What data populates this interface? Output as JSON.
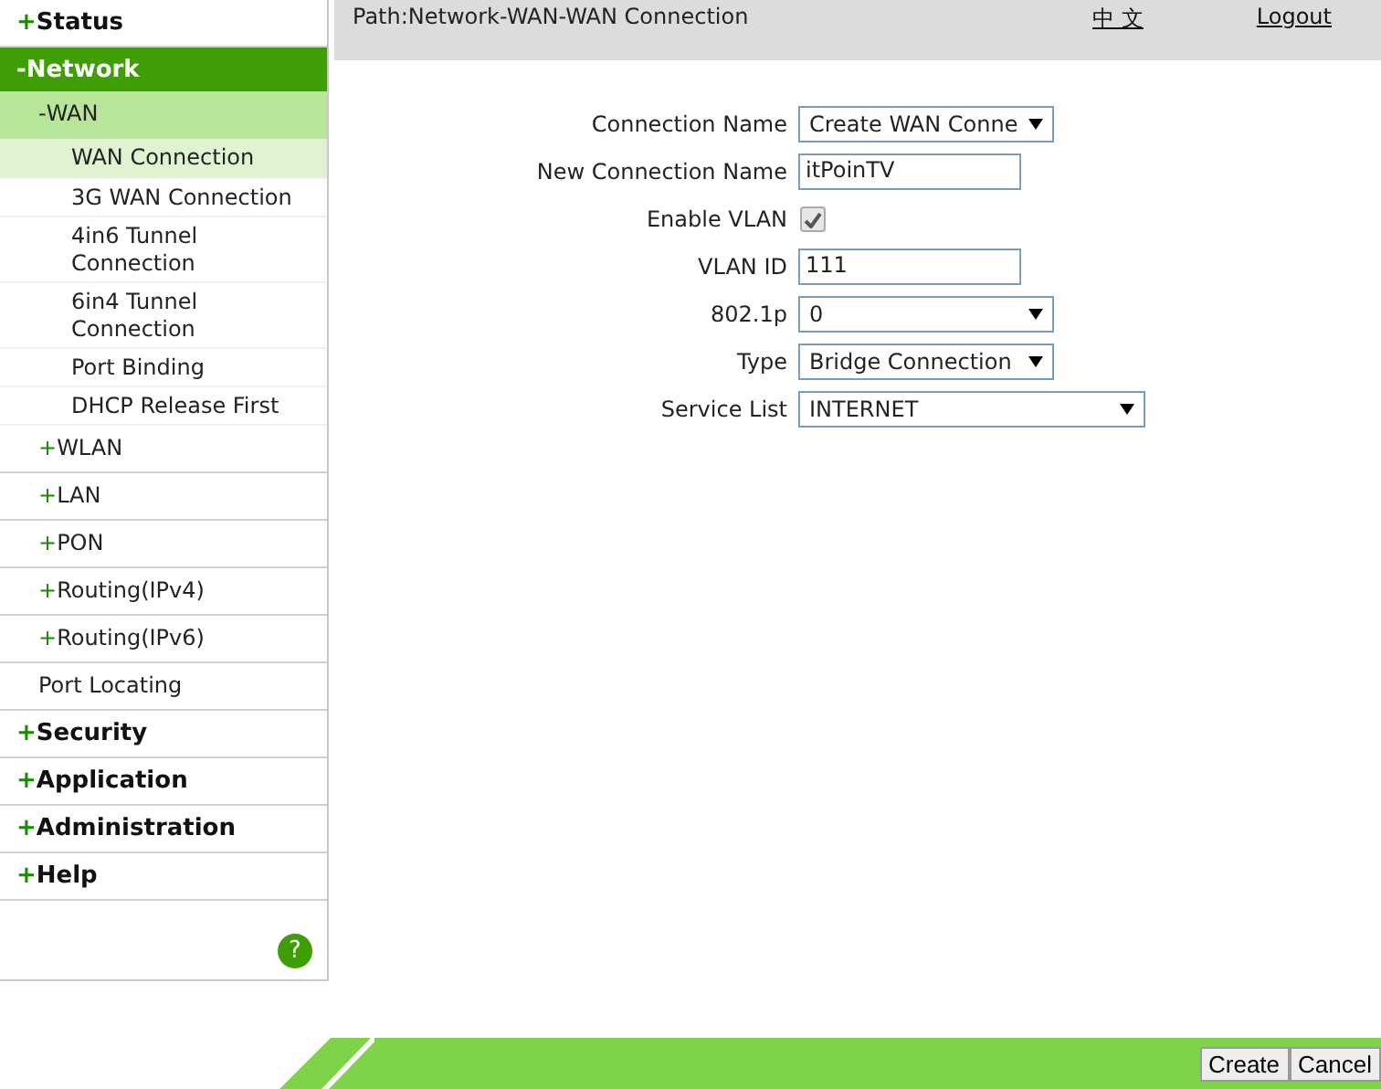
{
  "sidebar": {
    "items": [
      {
        "marker": "+",
        "label": "Status",
        "selected": false
      },
      {
        "marker": "-",
        "label": "Network",
        "selected": true,
        "children": [
          {
            "marker": "-",
            "label": "WAN",
            "selected": true,
            "children": [
              {
                "label": "WAN Connection",
                "selected": true
              },
              {
                "label": "3G WAN Connection",
                "selected": false
              },
              {
                "label": "4in6 Tunnel Connection",
                "selected": false
              },
              {
                "label": "6in4 Tunnel Connection",
                "selected": false
              },
              {
                "label": "Port Binding",
                "selected": false
              },
              {
                "label": "DHCP Release First",
                "selected": false
              }
            ]
          },
          {
            "marker": "+",
            "label": "WLAN",
            "selected": false
          },
          {
            "marker": "+",
            "label": "LAN",
            "selected": false
          },
          {
            "marker": "+",
            "label": "PON",
            "selected": false
          },
          {
            "marker": "+",
            "label": "Routing(IPv4)",
            "selected": false
          },
          {
            "marker": "+",
            "label": "Routing(IPv6)",
            "selected": false
          },
          {
            "label": "Port Locating",
            "selected": false
          }
        ]
      },
      {
        "marker": "+",
        "label": "Security",
        "selected": false
      },
      {
        "marker": "+",
        "label": "Application",
        "selected": false
      },
      {
        "marker": "+",
        "label": "Administration",
        "selected": false
      },
      {
        "marker": "+",
        "label": "Help",
        "selected": false
      }
    ],
    "help_icon": "?"
  },
  "header": {
    "path": "Path:Network-WAN-WAN Connection",
    "language_link": "中 文",
    "logout_link": "Logout"
  },
  "form": {
    "fields": [
      {
        "kind": "select",
        "label": "Connection Name",
        "value": "Create WAN Conne"
      },
      {
        "kind": "text",
        "label": "New Connection Name",
        "value": "itPoinTV"
      },
      {
        "kind": "checkbox",
        "label": "Enable VLAN",
        "checked": true
      },
      {
        "kind": "text",
        "label": "VLAN ID",
        "value": "111"
      },
      {
        "kind": "select",
        "label": "802.1p",
        "value": "0"
      },
      {
        "kind": "select",
        "label": "Type",
        "value": "Bridge Connection"
      },
      {
        "kind": "wideselect",
        "label": "Service List",
        "value": "INTERNET"
      }
    ]
  },
  "footer": {
    "buttons": [
      "Create",
      "Cancel"
    ]
  }
}
